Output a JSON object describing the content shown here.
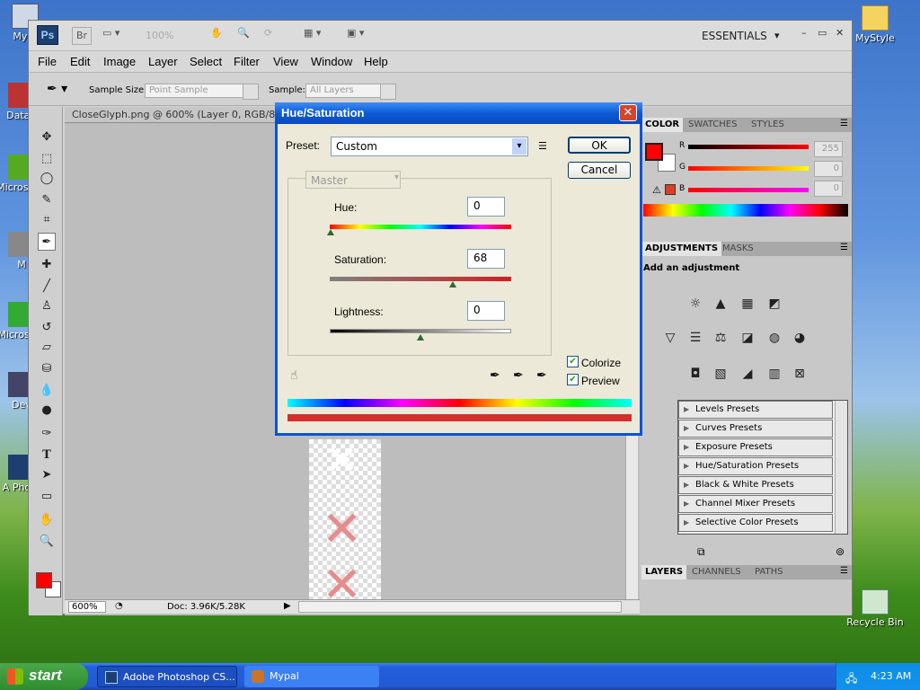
{
  "desktop": {
    "icons": [
      {
        "label": "My C"
      },
      {
        "label": "MyStyle"
      },
      {
        "label": "DataV"
      },
      {
        "label": "Micros C+"
      },
      {
        "label": "M"
      },
      {
        "label": "Micros Ba"
      },
      {
        "label": "Dev"
      },
      {
        "label": "A Photo"
      },
      {
        "label": "Recycle Bin"
      }
    ]
  },
  "app": {
    "logo": "Ps",
    "br": "Br",
    "zoom": "100%",
    "workspace": "ESSENTIALS"
  },
  "menu": [
    "File",
    "Edit",
    "Image",
    "Layer",
    "Select",
    "Filter",
    "View",
    "Window",
    "Help"
  ],
  "options": {
    "sample_size_label": "Sample Size:",
    "sample_size_value": "Point Sample",
    "sample_label": "Sample:",
    "sample_value": "All Layers"
  },
  "document": {
    "tab": "CloseGlyph.png @ 600% (Layer 0, RGB/8",
    "zoom": "600%",
    "doc_size": "Doc: 3.96K/5.28K"
  },
  "panels": {
    "color_tabs": [
      "COLOR",
      "SWATCHES",
      "STYLES"
    ],
    "channels": [
      {
        "label": "R",
        "value": "255"
      },
      {
        "label": "G",
        "value": "0"
      },
      {
        "label": "B",
        "value": "0"
      }
    ],
    "adjustment_tabs": [
      "ADJUSTMENTS",
      "MASKS"
    ],
    "add_adjustment": "Add an adjustment",
    "presets": [
      "Levels Presets",
      "Curves Presets",
      "Exposure Presets",
      "Hue/Saturation Presets",
      "Black & White Presets",
      "Channel Mixer Presets",
      "Selective Color Presets"
    ],
    "layer_tabs": [
      "LAYERS",
      "CHANNELS",
      "PATHS"
    ],
    "colors": {
      "foreground": "#ff0000",
      "background": "#ffffff"
    }
  },
  "dialog": {
    "title": "Hue/Saturation",
    "preset_label": "Preset:",
    "preset_value": "Custom",
    "edit_value": "Master",
    "hue_label": "Hue:",
    "hue_value": "0",
    "saturation_label": "Saturation:",
    "saturation_value": "68",
    "lightness_label": "Lightness:",
    "lightness_value": "0",
    "ok": "OK",
    "cancel": "Cancel",
    "colorize_label": "Colorize",
    "preview_label": "Preview",
    "colorize_checked": true,
    "preview_checked": true
  },
  "taskbar": {
    "start": "start",
    "tasks": [
      "Adobe Photoshop CS...",
      "Mypal"
    ],
    "time": "4:23 AM"
  }
}
